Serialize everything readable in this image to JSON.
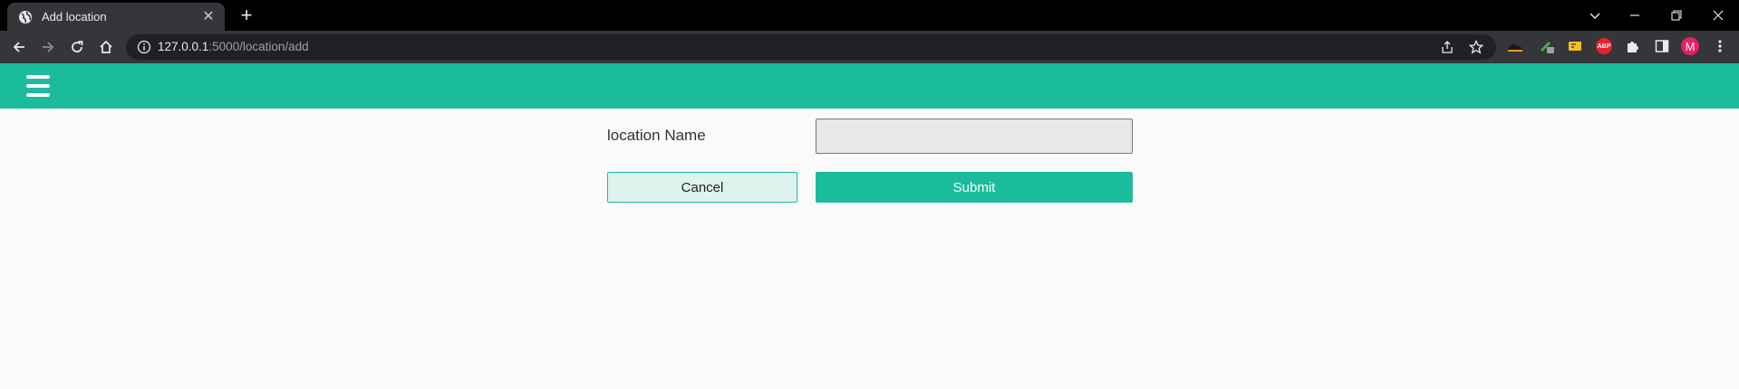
{
  "browser": {
    "tab": {
      "title": "Add location",
      "close_glyph": "✕",
      "favicon": "globe-icon"
    },
    "new_tab_glyph": "+",
    "address": {
      "host": "127.0.0.1",
      "path": ":5000/location/add"
    },
    "profile_initial": "M",
    "extensions": [
      "extension-shoe-icon",
      "extension-pen-icon",
      "extension-yellow-icon",
      "adblock-plus-icon",
      "puzzle-icon",
      "side-panel-icon"
    ],
    "abp_label": "ABP"
  },
  "app": {
    "header_color": "#1abc9c",
    "menu_icon": "hamburger-menu-icon"
  },
  "form": {
    "location_label": "location Name",
    "location_value": "",
    "cancel_label": "Cancel",
    "submit_label": "Submit"
  },
  "colors": {
    "accent": "#1abc9c",
    "cancel_bg": "#dff3ee",
    "input_bg": "#e8e8e8"
  }
}
